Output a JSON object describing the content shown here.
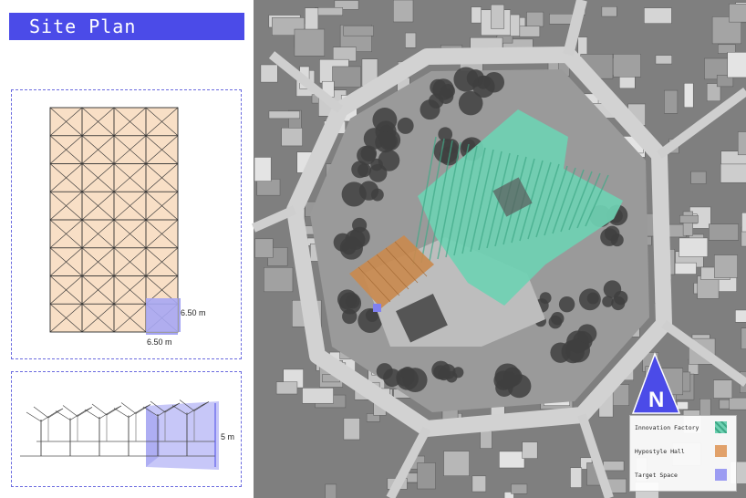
{
  "header": {
    "title": "Site Plan"
  },
  "plan": {
    "rows": 8,
    "cols": 4,
    "width_label": "6.50 m",
    "height_label": "6.50 m"
  },
  "elevation": {
    "height_label": "5 m"
  },
  "map": {
    "north_label": "N",
    "legend": [
      {
        "label": "Innovation Factory",
        "color": "#6fd1b3"
      },
      {
        "label": "Hypostyle Hall",
        "color": "#e1a16a"
      },
      {
        "label": "Target Space",
        "color": "#9c9cf2"
      }
    ]
  },
  "colors": {
    "accent": "#4b4be8",
    "grid_fill": "#f8dfc6",
    "target": "#a7a7f3"
  }
}
